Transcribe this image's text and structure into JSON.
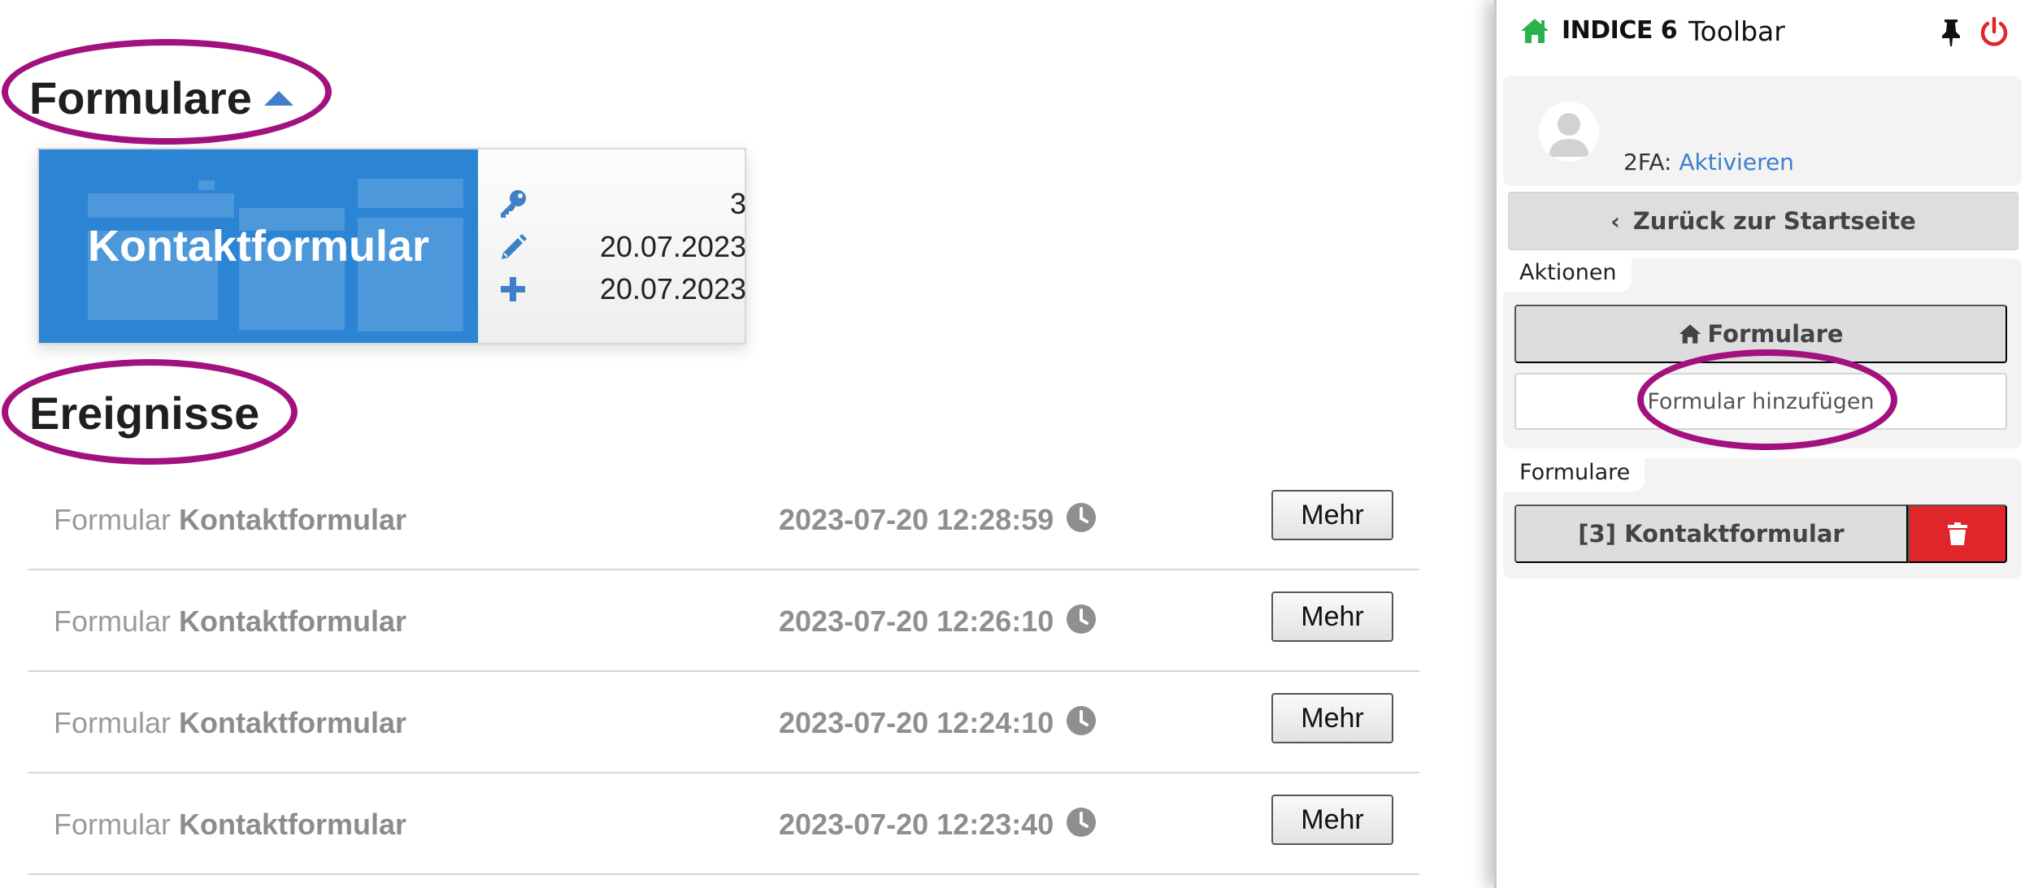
{
  "main": {
    "forms_heading": "Formulare",
    "events_heading": "Ereignisse",
    "form_card": {
      "thumbnail_title": "Kontaktformular",
      "id_value": "3",
      "modified_date": "20.07.2023",
      "created_date": "20.07.2023",
      "icons": [
        "key-icon",
        "pencil-icon",
        "plus-icon"
      ],
      "accent_color": "#2c84d4"
    },
    "events": [
      {
        "prefix": "Formular",
        "form_name": "Kontaktformular",
        "timestamp": "2023-07-20 12:28:59",
        "button_label": "Mehr"
      },
      {
        "prefix": "Formular",
        "form_name": "Kontaktformular",
        "timestamp": "2023-07-20 12:26:10",
        "button_label": "Mehr"
      },
      {
        "prefix": "Formular",
        "form_name": "Kontaktformular",
        "timestamp": "2023-07-20 12:24:10",
        "button_label": "Mehr"
      },
      {
        "prefix": "Formular",
        "form_name": "Kontaktformular",
        "timestamp": "2023-07-20 12:23:40",
        "button_label": "Mehr"
      }
    ],
    "annotation_color": "#a3117f"
  },
  "toolbar": {
    "brand": "INDICE 6",
    "title": "Toolbar",
    "home_icon_color": "#2bb24c",
    "power_icon_color": "#e0262a",
    "user": {
      "twofa_label": "2FA:",
      "twofa_link": "Aktivieren"
    },
    "back_button_label": "Zurück zur Startseite",
    "actions": {
      "section_label": "Aktionen",
      "forms_button_label": "Formulare",
      "add_form_button_label": "Formular hinzufügen"
    },
    "forms": {
      "section_label": "Formulare",
      "items": [
        {
          "label": "[3] Kontaktformular",
          "delete_color": "#e0262a"
        }
      ]
    }
  }
}
